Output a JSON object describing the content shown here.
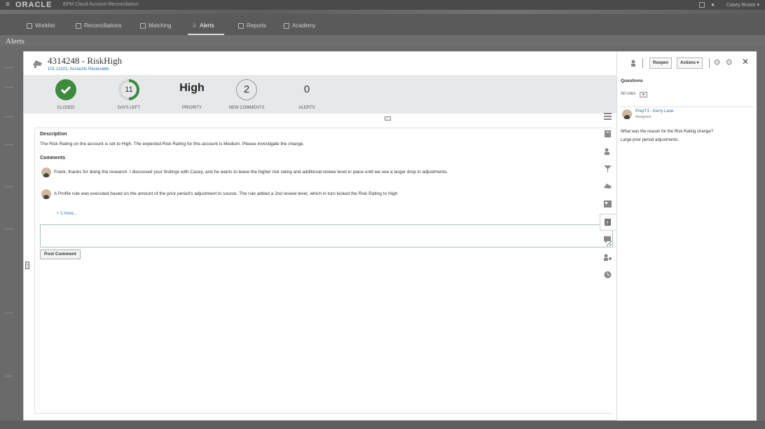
{
  "topbar": {
    "menu_glyph": "≡",
    "logo": "ORACLE",
    "app_title": "EPM Cloud Account Reconciliation",
    "user": "Casey Brown ▾"
  },
  "nav": {
    "items": [
      {
        "label": "Worklist",
        "icon": "worklist-icon"
      },
      {
        "label": "Reconciliations",
        "icon": "reconciliations-icon"
      },
      {
        "label": "Matching",
        "icon": "matching-icon"
      },
      {
        "label": "Alerts",
        "icon": "alerts-icon"
      },
      {
        "label": "Reports",
        "icon": "reports-icon"
      },
      {
        "label": "Academy",
        "icon": "academy-icon"
      }
    ],
    "active": "Alerts"
  },
  "page_title": "Alerts",
  "alert": {
    "title": "4314248 - RiskHigh",
    "subtitle": "101-12101: Accounts Receivable",
    "stats": {
      "status_label": "CLOSED",
      "days_left": "11",
      "days_left_label": "DAYS LEFT",
      "priority": "High",
      "priority_label": "PRIORITY",
      "new_comments": "2",
      "new_comments_label": "NEW COMMENTS",
      "alerts": "0",
      "alerts_label": "ALERTS"
    },
    "description_heading": "Description",
    "description": "The Risk Rating on the account is set to High. The expected Risk Rating for this account is Medium. Please investigate the change.",
    "comments_heading": "Comments",
    "comments": [
      "Frank, thanks for doing the research. I discussed your findings with Casey, and he wants to leave the higher risk rating and additional review level in place until we see a larger drop in adjustments.",
      "A Profile rule was executed based on the amount of the prior period's adjustment to source. The rule added a 2nd review level, which in turn kicked the Risk Rating to High."
    ],
    "more_link": "+ 1 more...",
    "post_button": "Post Comment"
  },
  "right_panel": {
    "reopen": "Reopen",
    "actions": "Actions ▾",
    "questions_heading": "Questions",
    "roles_filter": "All roles",
    "assignee_name": "PrepT1 - Kerry Lane",
    "assignee_role": "Assignee",
    "question": "What was the reason for the Risk Rating change?",
    "answer": "Large prior period adjustments."
  },
  "colors": {
    "closed_green": "#3d8b3d",
    "days_ring": "#3d8b3d",
    "link_blue": "#2a6fa8"
  }
}
